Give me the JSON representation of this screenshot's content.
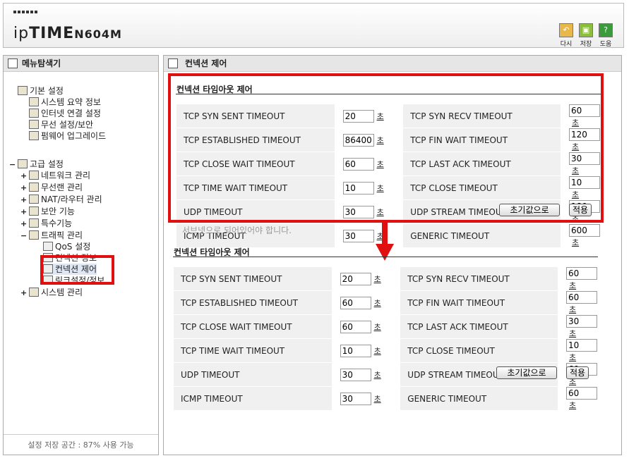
{
  "header": {
    "brand_ip": "ip",
    "brand_time": "TIME",
    "model": "N604M",
    "buttons": [
      {
        "label": "다시",
        "icon": "undo-icon"
      },
      {
        "label": "저장",
        "icon": "save-icon"
      },
      {
        "label": "도움",
        "icon": "help-icon"
      }
    ]
  },
  "sidebar": {
    "title": "메뉴탐색기",
    "groups": [
      {
        "label": "기본 설정",
        "items": [
          "시스템 요약 정보",
          "인터넷 연결 설정",
          "무선 설정/보안",
          "펌웨어 업그레이드"
        ]
      },
      {
        "label": "고급 설정",
        "items": [
          "네트워크 관리",
          "무선랜 관리",
          "NAT/라우터 관리",
          "보안 기능",
          "특수기능",
          "트래픽 관리",
          "시스템 관리"
        ]
      }
    ],
    "traffic_items": [
      "QoS 설정",
      "컨넥션 정보",
      "컨넥션 제어",
      "링크설정/정보"
    ],
    "storage_text": "설정 저장 공간 : 87% 사용 가능"
  },
  "main": {
    "title": "컨넥션 제어",
    "note": "서브넷으로 되어있어야 합니다.",
    "sections": [
      {
        "title": "컨넥션 타임아웃 제어",
        "rows": [
          [
            "TCP SYN SENT TIMEOUT",
            "20",
            "TCP SYN RECV TIMEOUT",
            "60"
          ],
          [
            "TCP ESTABLISHED TIMEOUT",
            "86400",
            "TCP FIN WAIT TIMEOUT",
            "120"
          ],
          [
            "TCP CLOSE WAIT TIMEOUT",
            "60",
            "TCP LAST ACK TIMEOUT",
            "30"
          ],
          [
            "TCP TIME WAIT TIMEOUT",
            "10",
            "TCP CLOSE TIMEOUT",
            "10"
          ],
          [
            "UDP TIMEOUT",
            "30",
            "UDP STREAM TIMEOUT",
            "180"
          ],
          [
            "ICMP TIMEOUT",
            "30",
            "GENERIC TIMEOUT",
            "600"
          ]
        ]
      },
      {
        "title": "컨넥션 타임아웃 제어",
        "rows": [
          [
            "TCP SYN SENT TIMEOUT",
            "20",
            "TCP SYN RECV TIMEOUT",
            "60"
          ],
          [
            "TCP ESTABLISHED TIMEOUT",
            "60",
            "TCP FIN WAIT TIMEOUT",
            "60"
          ],
          [
            "TCP CLOSE WAIT TIMEOUT",
            "60",
            "TCP LAST ACK TIMEOUT",
            "30"
          ],
          [
            "TCP TIME WAIT TIMEOUT",
            "10",
            "TCP CLOSE TIMEOUT",
            "10"
          ],
          [
            "UDP TIMEOUT",
            "30",
            "UDP STREAM TIMEOUT",
            "60"
          ],
          [
            "ICMP TIMEOUT",
            "30",
            "GENERIC TIMEOUT",
            "60"
          ]
        ]
      }
    ],
    "unit": "초",
    "reset_label": "초기값으로",
    "apply_label": "적용"
  },
  "colors": {
    "highlight": "#e01010",
    "accent": "#3a9b3a"
  }
}
